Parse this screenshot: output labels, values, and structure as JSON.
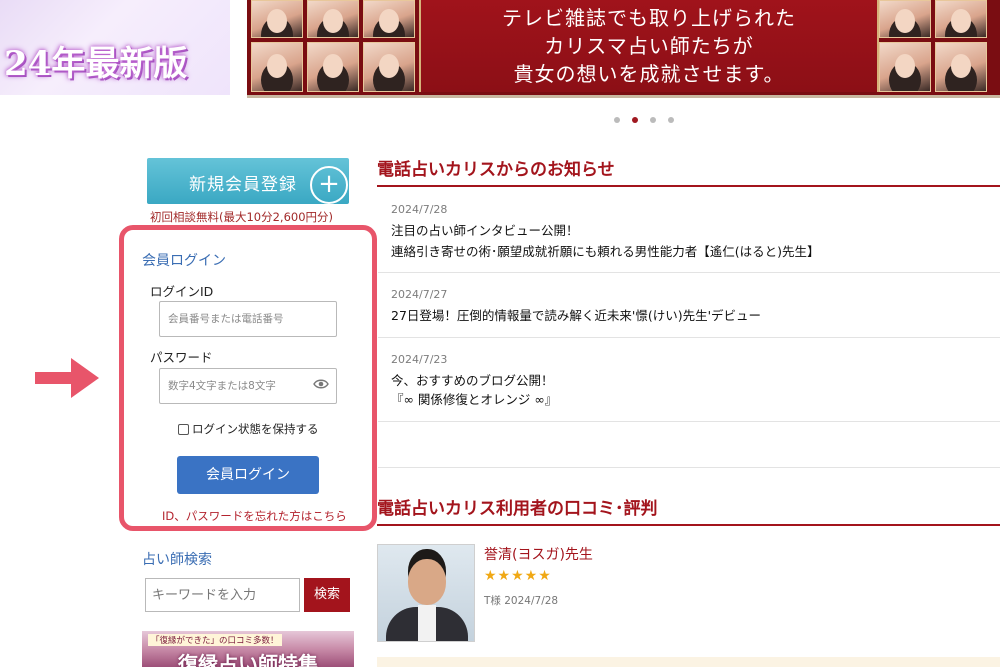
{
  "banner": {
    "left_text": "24年最新版",
    "main_lines": [
      "テレビ雑誌でも取り上げられた",
      "カリスマ占い師たちが",
      "貴女の想いを成就させます。"
    ],
    "carousel_dots": 4,
    "carousel_active_index": 1
  },
  "register": {
    "label": "新規会員登録",
    "plus_symbol": "+",
    "note": "初回相談無料(最大10分2,600円分)"
  },
  "login": {
    "title": "会員ログイン",
    "id_label": "ログインID",
    "id_placeholder": "会員番号または電話番号",
    "password_label": "パスワード",
    "password_placeholder": "数字4文字または8文字",
    "keep_label": "ログイン状態を保持する",
    "keep_checked": false,
    "button_label": "会員ログイン",
    "forgot_link": "ID、パスワードを忘れた方はこちら"
  },
  "annotation": {
    "highlight_color": "#e8556a",
    "arrow_icon": "arrow-right-icon"
  },
  "search": {
    "title": "占い師検索",
    "placeholder": "キーワードを入力",
    "button_label": "検索"
  },
  "feature_banner": {
    "tag": "「復縁ができた」の口コミ多数！",
    "title": "復縁占い師特集"
  },
  "news": {
    "heading": "電話占いカリスからのお知らせ",
    "items": [
      {
        "date": "2024/7/28",
        "lines": [
          "注目の占い師インタビュー公開！",
          "連絡引き寄せの術･願望成就祈願にも頼れる男性能力者【遙仁(はると)先生】"
        ]
      },
      {
        "date": "2024/7/27",
        "lines": [
          "27日登場！圧倒的情報量で読み解く近未来'憬(けい)先生'デビュー"
        ]
      },
      {
        "date": "2024/7/23",
        "lines": [
          "今、おすすめのブログ公開！",
          "『∞ 関係修復とオレンジ ∞』"
        ]
      }
    ]
  },
  "reviews": {
    "heading": "電話占いカリス利用者の口コミ･評判",
    "items": [
      {
        "name": "誉清(ヨスガ)先生",
        "stars": "★★★★★",
        "rating": 5,
        "meta": "T様 2024/7/28"
      }
    ]
  },
  "colors": {
    "brand_red": "#a3141c",
    "link_blue": "#3a6db3",
    "button_blue": "#3a73c4",
    "register_teal": "#3aa8c3",
    "star_gold": "#f0a814"
  }
}
